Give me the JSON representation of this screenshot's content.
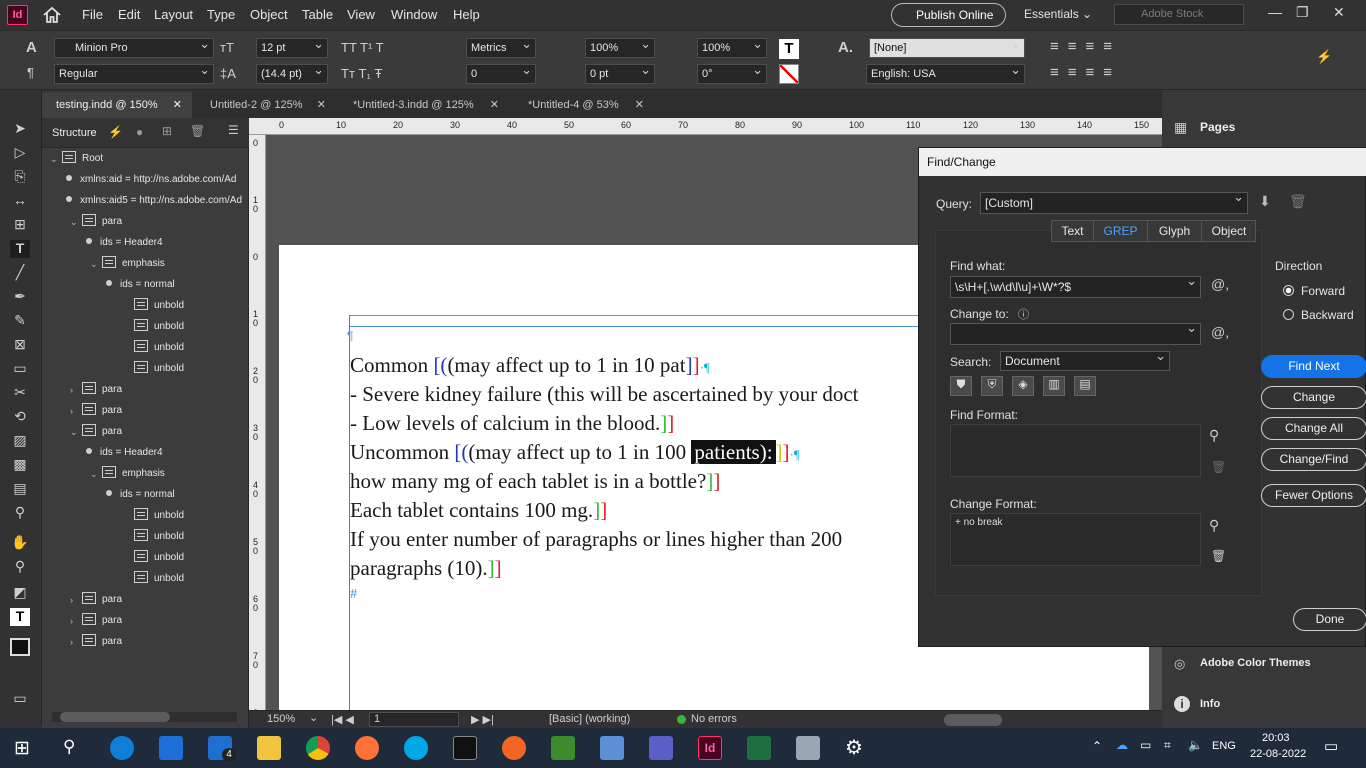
{
  "app": {
    "icon": "Id",
    "menus": [
      "File",
      "Edit",
      "Layout",
      "Type",
      "Object",
      "Table",
      "View",
      "Window",
      "Help"
    ],
    "publish": "Publish Online",
    "workspace": "Essentials",
    "stock_placeholder": "Adobe Stock"
  },
  "control": {
    "font": "Minion Pro",
    "style": "Regular",
    "size": "12 pt",
    "leading": "(14.4 pt)",
    "kerning": "Metrics",
    "tracking": "0",
    "vscale": "100%",
    "hscale": "100%",
    "baseline": "0 pt",
    "skew": "0°",
    "charstyle": "[None]",
    "language": "English: USA"
  },
  "tabs": [
    "testing.indd @ 150%",
    "Untitled-2 @ 125%",
    "*Untitled-3.indd @ 125%",
    "*Untitled-4 @ 53%"
  ],
  "structure": {
    "title": "Structure",
    "rows": [
      {
        "kind": "elem",
        "label": "Root",
        "indent": 8,
        "tri": "⌄"
      },
      {
        "kind": "attr",
        "label": "xmlns:aid = http://ns.adobe.com/Ad",
        "indent": 24
      },
      {
        "kind": "attr",
        "label": "xmlns:aid5 = http://ns.adobe.com/Ad",
        "indent": 24
      },
      {
        "kind": "elem",
        "label": "para",
        "indent": 28,
        "tri": "⌄"
      },
      {
        "kind": "attr",
        "label": "ids = Header4",
        "indent": 44
      },
      {
        "kind": "elem",
        "label": "emphasis",
        "indent": 48,
        "tri": "⌄"
      },
      {
        "kind": "attr",
        "label": "ids = normal",
        "indent": 64
      },
      {
        "kind": "elem",
        "label": "unbold",
        "indent": 80
      },
      {
        "kind": "elem",
        "label": "unbold",
        "indent": 80
      },
      {
        "kind": "elem",
        "label": "unbold",
        "indent": 80
      },
      {
        "kind": "elem",
        "label": "unbold",
        "indent": 80
      },
      {
        "kind": "elem",
        "label": "para",
        "indent": 28,
        "tri": "›"
      },
      {
        "kind": "elem",
        "label": "para",
        "indent": 28,
        "tri": "›"
      },
      {
        "kind": "elem",
        "label": "para",
        "indent": 28,
        "tri": "⌄"
      },
      {
        "kind": "attr",
        "label": "ids = Header4",
        "indent": 44
      },
      {
        "kind": "elem",
        "label": "emphasis",
        "indent": 48,
        "tri": "⌄"
      },
      {
        "kind": "attr",
        "label": "ids = normal",
        "indent": 64
      },
      {
        "kind": "elem",
        "label": "unbold",
        "indent": 80
      },
      {
        "kind": "elem",
        "label": "unbold",
        "indent": 80
      },
      {
        "kind": "elem",
        "label": "unbold",
        "indent": 80
      },
      {
        "kind": "elem",
        "label": "unbold",
        "indent": 80
      },
      {
        "kind": "elem",
        "label": "para",
        "indent": 28,
        "tri": "›"
      },
      {
        "kind": "elem",
        "label": "para",
        "indent": 28,
        "tri": "›"
      },
      {
        "kind": "elem",
        "label": "para",
        "indent": 28,
        "tri": "›"
      }
    ]
  },
  "ruler": {
    "h": [
      "0",
      "10",
      "20",
      "30",
      "40",
      "50",
      "60",
      "70",
      "80",
      "90",
      "100",
      "110",
      "120",
      "130",
      "140",
      "150"
    ],
    "v": [
      "0",
      "1 0",
      "0",
      "1 0",
      "2 0",
      "3 0",
      "4 0",
      "5 0",
      "6 0",
      "7 0",
      "8"
    ]
  },
  "doc": {
    "l1a": "Common",
    "l1b": "(may affect up to 1 in 10 pat",
    "l2": "- Severe kidney failure (this will be ascertained by your doct",
    "l3": "- Low levels of calcium in the blood.",
    "l4a": "Uncommon",
    "l4b": "(may affect up to 1 in 100",
    "l4sel": "patients):",
    "l5": "how many mg of each tablet is in a bottle?",
    "l6": "Each tablet contains 100 mg.",
    "l7": "If you enter number of paragraphs or lines higher than 200",
    "l8": "paragraphs (10).",
    "end": "#"
  },
  "status": {
    "zoom": "150%",
    "page": "1",
    "style": "[Basic] (working)",
    "errors": "No errors"
  },
  "panels": {
    "pages": "Pages",
    "color": "Adobe Color Themes",
    "info": "Info"
  },
  "dialog": {
    "title": "Find/Change",
    "query_label": "Query:",
    "query": "[Custom]",
    "tabs": [
      "Text",
      "GREP",
      "Glyph",
      "Object"
    ],
    "find_label": "Find what:",
    "find": "\\s\\H+[.\\w\\d\\l\\u]+\\W*?$",
    "change_label": "Change to:",
    "change": "",
    "search_label": "Search:",
    "search": "Document",
    "findfmt_label": "Find Format:",
    "changefmt_label": "Change Format:",
    "changefmt": "+ no break",
    "direction": "Direction",
    "forward": "Forward",
    "backward": "Backward",
    "buttons": {
      "find_next": "Find Next",
      "change": "Change",
      "change_all": "Change All",
      "change_find": "Change/Find",
      "fewer": "Fewer Options",
      "done": "Done"
    }
  },
  "taskbar": {
    "lang": "ENG",
    "time": "20:03",
    "date": "22-08-2022",
    "mail_badge": "4"
  }
}
